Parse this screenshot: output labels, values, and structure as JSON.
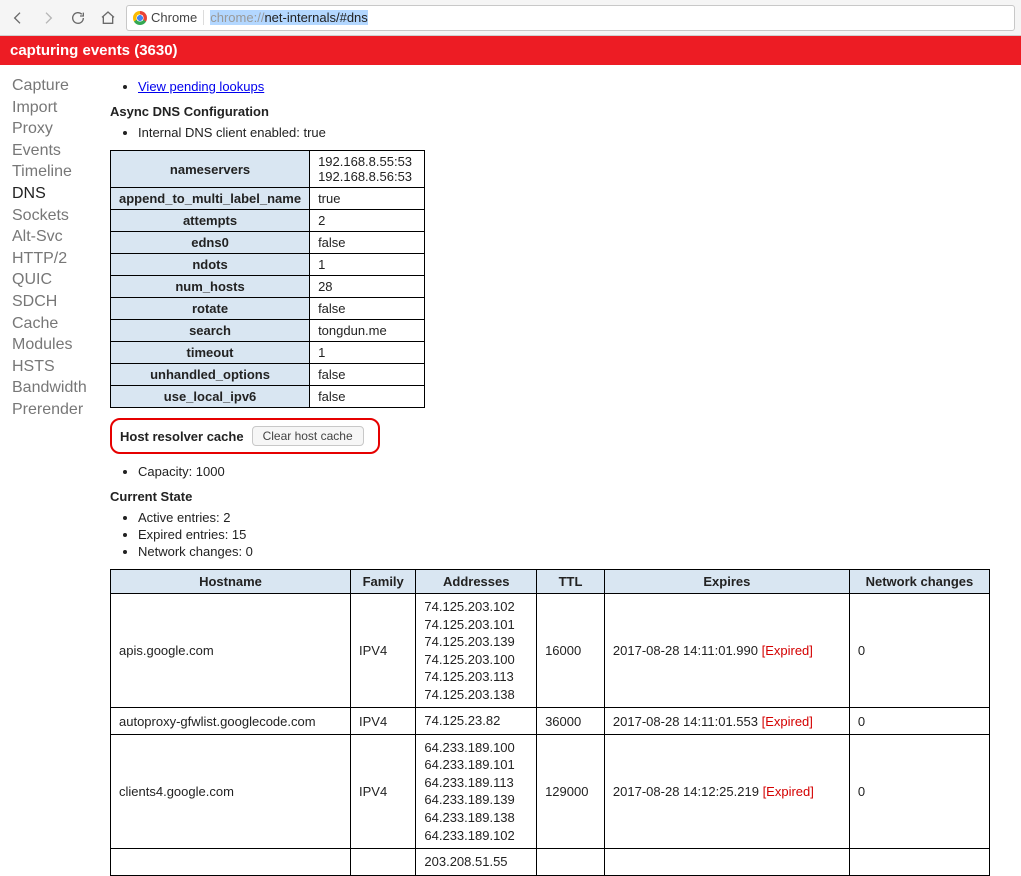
{
  "toolbar": {
    "badge_label": "Chrome",
    "url_scheme": "chrome://",
    "url_path": "net-internals/#dns"
  },
  "banner": "capturing events (3630)",
  "sidebar": {
    "items": [
      {
        "label": "Capture",
        "active": false
      },
      {
        "label": "Import",
        "active": false
      },
      {
        "label": "Proxy",
        "active": false
      },
      {
        "label": "Events",
        "active": false
      },
      {
        "label": "Timeline",
        "active": false
      },
      {
        "label": "DNS",
        "active": true
      },
      {
        "label": "Sockets",
        "active": false
      },
      {
        "label": "Alt-Svc",
        "active": false
      },
      {
        "label": "HTTP/2",
        "active": false
      },
      {
        "label": "QUIC",
        "active": false
      },
      {
        "label": "SDCH",
        "active": false
      },
      {
        "label": "Cache",
        "active": false
      },
      {
        "label": "Modules",
        "active": false
      },
      {
        "label": "HSTS",
        "active": false
      },
      {
        "label": "Bandwidth",
        "active": false
      },
      {
        "label": "Prerender",
        "active": false
      }
    ]
  },
  "main": {
    "pending_link": "View pending lookups",
    "async_heading": "Async DNS Configuration",
    "internal_client": "Internal DNS client enabled: true",
    "config_rows": [
      {
        "k": "nameservers",
        "v": "192.168.8.55:53\n192.168.8.56:53"
      },
      {
        "k": "append_to_multi_label_name",
        "v": "true"
      },
      {
        "k": "attempts",
        "v": "2"
      },
      {
        "k": "edns0",
        "v": "false"
      },
      {
        "k": "ndots",
        "v": "1"
      },
      {
        "k": "num_hosts",
        "v": "28"
      },
      {
        "k": "rotate",
        "v": "false"
      },
      {
        "k": "search",
        "v": "tongdun.me"
      },
      {
        "k": "timeout",
        "v": "1"
      },
      {
        "k": "unhandled_options",
        "v": "false"
      },
      {
        "k": "use_local_ipv6",
        "v": "false"
      }
    ],
    "clear_section_label": "Host resolver cache",
    "clear_button": "Clear host cache",
    "capacity": "Capacity: 1000",
    "current_state_heading": "Current State",
    "state": [
      "Active entries: 2",
      "Expired entries: 15",
      "Network changes: 0"
    ],
    "hosts": {
      "headers": [
        "Hostname",
        "Family",
        "Addresses",
        "TTL",
        "Expires",
        "Network changes"
      ],
      "rows": [
        {
          "host": "apis.google.com",
          "family": "IPV4",
          "addresses": "74.125.203.102\n74.125.203.101\n74.125.203.139\n74.125.203.100\n74.125.203.113\n74.125.203.138",
          "ttl": "16000",
          "expires": "2017-08-28 14:11:01.990",
          "expired": "[Expired]",
          "changes": "0"
        },
        {
          "host": "autoproxy-gfwlist.googlecode.com",
          "family": "IPV4",
          "addresses": "74.125.23.82",
          "ttl": "36000",
          "expires": "2017-08-28 14:11:01.553",
          "expired": "[Expired]",
          "changes": "0"
        },
        {
          "host": "clients4.google.com",
          "family": "IPV4",
          "addresses": "64.233.189.100\n64.233.189.101\n64.233.189.113\n64.233.189.139\n64.233.189.138\n64.233.189.102",
          "ttl": "129000",
          "expires": "2017-08-28 14:12:25.219",
          "expired": "[Expired]",
          "changes": "0"
        },
        {
          "host": "",
          "family": "",
          "addresses": "203.208.51.55",
          "ttl": "",
          "expires": "",
          "expired": "",
          "changes": ""
        }
      ]
    }
  }
}
